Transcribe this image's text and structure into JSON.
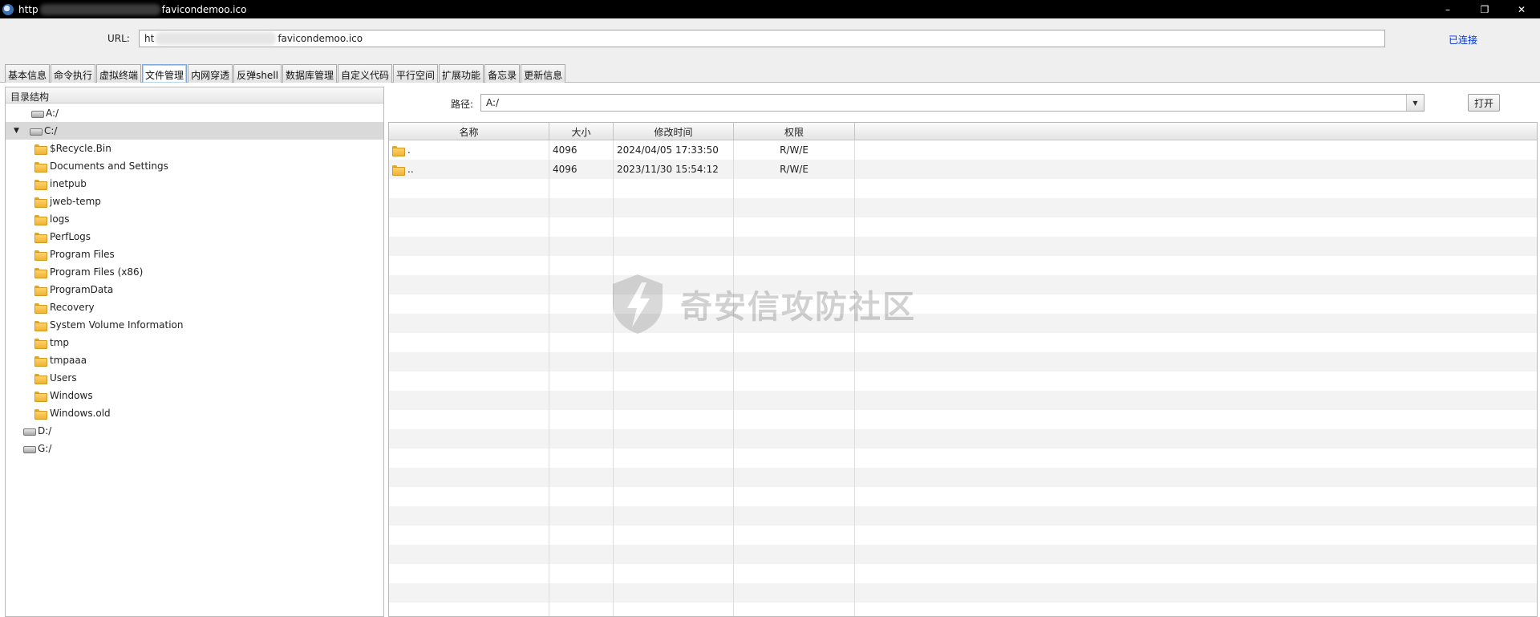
{
  "window": {
    "title_prefix": "http",
    "title_suffix": "favicondemoo.ico",
    "controls": [
      "–",
      "❐",
      "✕"
    ]
  },
  "url_bar": {
    "label": "URL:",
    "value_prefix": "ht",
    "value_suffix": "favicondemoo.ico",
    "status": "已连接"
  },
  "tabs": [
    "基本信息",
    "命令执行",
    "虚拟终端",
    "文件管理",
    "内网穿透",
    "反弹shell",
    "数据库管理",
    "自定义代码",
    "平行空间",
    "扩展功能",
    "备忘录",
    "更新信息"
  ],
  "active_tab": "文件管理",
  "tree": {
    "header": "目录结构",
    "drives": [
      {
        "label": "A:/",
        "expanded": false
      },
      {
        "label": "C:/",
        "expanded": true,
        "selected": true,
        "children": [
          "$Recycle.Bin",
          "Documents and Settings",
          "inetpub",
          "jweb-temp",
          "logs",
          "PerfLogs",
          "Program Files",
          "Program Files (x86)",
          "ProgramData",
          "Recovery",
          "System Volume Information",
          "tmp",
          "tmpaaa",
          "Users",
          "Windows",
          "Windows.old"
        ]
      },
      {
        "label": "D:/",
        "expanded": false
      },
      {
        "label": "G:/",
        "expanded": false
      }
    ]
  },
  "path_bar": {
    "label": "路径:",
    "value": "A:/",
    "open_label": "打开"
  },
  "file_table": {
    "columns": [
      "名称",
      "大小",
      "修改时间",
      "权限"
    ],
    "rows": [
      {
        "name": ".",
        "size": "4096",
        "mtime": "2024/04/05 17:33:50",
        "perm": "R/W/E"
      },
      {
        "name": "..",
        "size": "4096",
        "mtime": "2023/11/30 15:54:12",
        "perm": "R/W/E"
      }
    ]
  },
  "watermark": "奇安信攻防社区",
  "colors": {
    "accent": "#0033cc",
    "selection": "#d9d9d9",
    "titlebar": "#000000"
  }
}
